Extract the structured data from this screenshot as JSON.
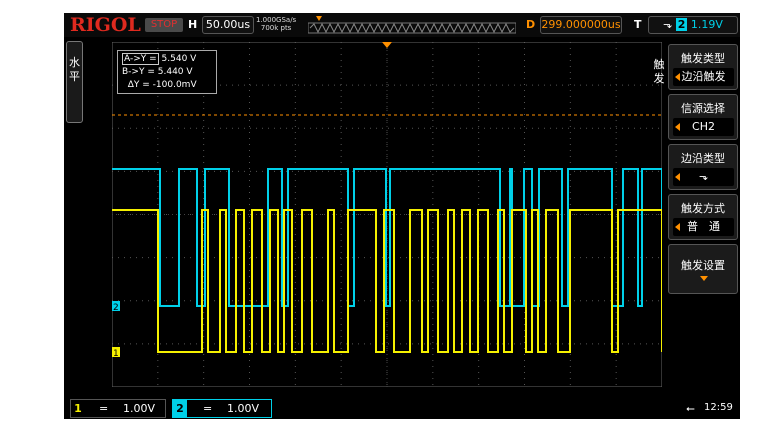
{
  "brand": "RIGOL",
  "run_state": "STOP",
  "horizontal": {
    "label": "H",
    "timebase": "50.00us"
  },
  "sample": {
    "rate": "1.000GSa/s",
    "points": "700k pts"
  },
  "delay": {
    "label": "D",
    "value": "299.000000us"
  },
  "trigger": {
    "label": "T",
    "channel": "2",
    "level": "1.19V"
  },
  "left_tab": {
    "label": "水平"
  },
  "cursor": {
    "a_label": "A->Y =",
    "a_value": "5.540 V",
    "b_label": "B->Y =",
    "b_value": "5.440 V",
    "d_label": "ΔY =",
    "d_value": "-100.0mV"
  },
  "menu": {
    "title": "触发",
    "items": [
      {
        "title": "触发类型",
        "value": "边沿触发"
      },
      {
        "title": "信源选择",
        "value": "CH2"
      },
      {
        "title": "边沿类型",
        "value": "falling-edge-icon"
      },
      {
        "title": "触发方式",
        "value": "普　通"
      },
      {
        "title": "触发设置",
        "value": ""
      }
    ]
  },
  "channels": [
    {
      "num": "1",
      "coupling": "=",
      "scale": "1.00V",
      "color": "#f5f000"
    },
    {
      "num": "2",
      "coupling": "=",
      "scale": "1.00V",
      "color": "#00d0e8"
    }
  ],
  "status": {
    "time": "12:59",
    "usb": "usb-icon"
  },
  "markers": {
    "ch1": "1",
    "ch2": "2"
  },
  "colors": {
    "ch1": "#f5f000",
    "ch2": "#00d0e8",
    "accent": "#ff9000",
    "brand": "#e02a1f"
  }
}
